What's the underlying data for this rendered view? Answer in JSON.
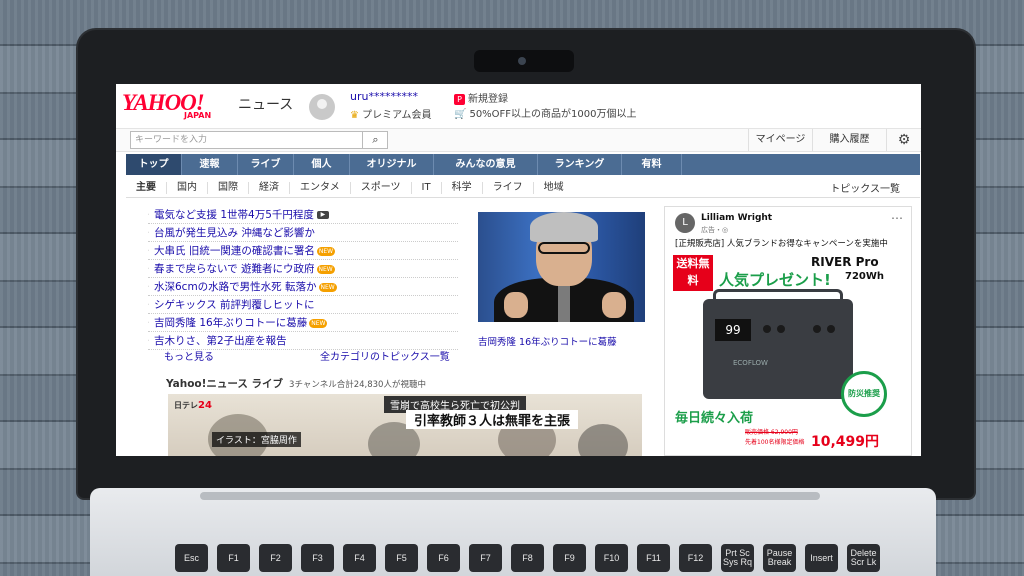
{
  "header": {
    "logo": "YAHOO!",
    "logo_sub": "JAPAN",
    "section": "ニュース",
    "username": "uru*********",
    "premium": "プレミアム会員",
    "signup": "新規登録",
    "promo": "50%OFF以上の商品が1000万個以上"
  },
  "search": {
    "placeholder": "キーワードを入力",
    "mypage": "マイページ",
    "history": "購入履歴"
  },
  "nav": {
    "items": [
      "トップ",
      "速報",
      "ライブ",
      "個人",
      "オリジナル",
      "みんなの意見",
      "ランキング",
      "有料"
    ]
  },
  "subnav": {
    "items": [
      "主要",
      "国内",
      "国際",
      "経済",
      "エンタメ",
      "スポーツ",
      "IT",
      "科学",
      "ライフ",
      "地域"
    ],
    "topics_link": "トピックス一覧"
  },
  "headlines": [
    "電気など支援 1世帯4万5千円程度",
    "台風が発生見込み 沖縄など影響か",
    "大串氏 旧統一関連の確認書に署名",
    "春まで戻らないで 遊難者にウ政府",
    "水深6cmの水路で男性水死 転落か",
    "シゲキックス 前評判覆しヒットに",
    "吉岡秀隆 16年ぶりコトーに葛藤",
    "吉木りさ、第2子出産を報告"
  ],
  "badges": {
    "new": "NEW"
  },
  "more_link": "もっと見る",
  "all_categories_link": "全カテゴリのトピックス一覧",
  "photo_caption": "吉岡秀隆 16年ぶりコトーに葛藤",
  "live": {
    "title": "Yahoo!ニュース ライブ",
    "viewers": "3チャンネル合計24,830人が視聴中",
    "channel_text": "日テレ",
    "channel_num": "24",
    "illustration_credit": "イラスト：宮脇周作",
    "lower_third_1": "雪崩で高校生ら死亡で初公判",
    "lower_third_2": "引率教師３人は無罪を主張"
  },
  "ad": {
    "avatar_letter": "L",
    "advertiser": "Lilliam Wright",
    "sponsored": "広告・",
    "text": "[正規販売店] 人気ブランドお得なキャンペーンを実施中",
    "sale_label": "送料無料",
    "present": "人気プレゼント!",
    "product": "RIVER Pro",
    "capacity": "720Wh",
    "display_value": "99",
    "brand": "ECOFLOW",
    "seal": "防災推奨",
    "daily": "毎日続々入荷",
    "old_price": "販売価格 62,900円",
    "limited": "先着100名様限定価格",
    "price": "10,499円"
  },
  "keyboard": {
    "keys": [
      "Esc",
      "F1",
      "F2",
      "F3",
      "F4",
      "F5",
      "F6",
      "F7",
      "F8",
      "F9",
      "F10",
      "F11",
      "F12",
      "Prt Sc Sys Rq",
      "Pause Break",
      "Insert",
      "Delete Scr Lk"
    ]
  },
  "colors": {
    "yahoo_red": "#ff0033",
    "nav_blue": "#4b6c93",
    "link_blue": "#1a0dab",
    "ad_green": "#1b9e4a"
  }
}
